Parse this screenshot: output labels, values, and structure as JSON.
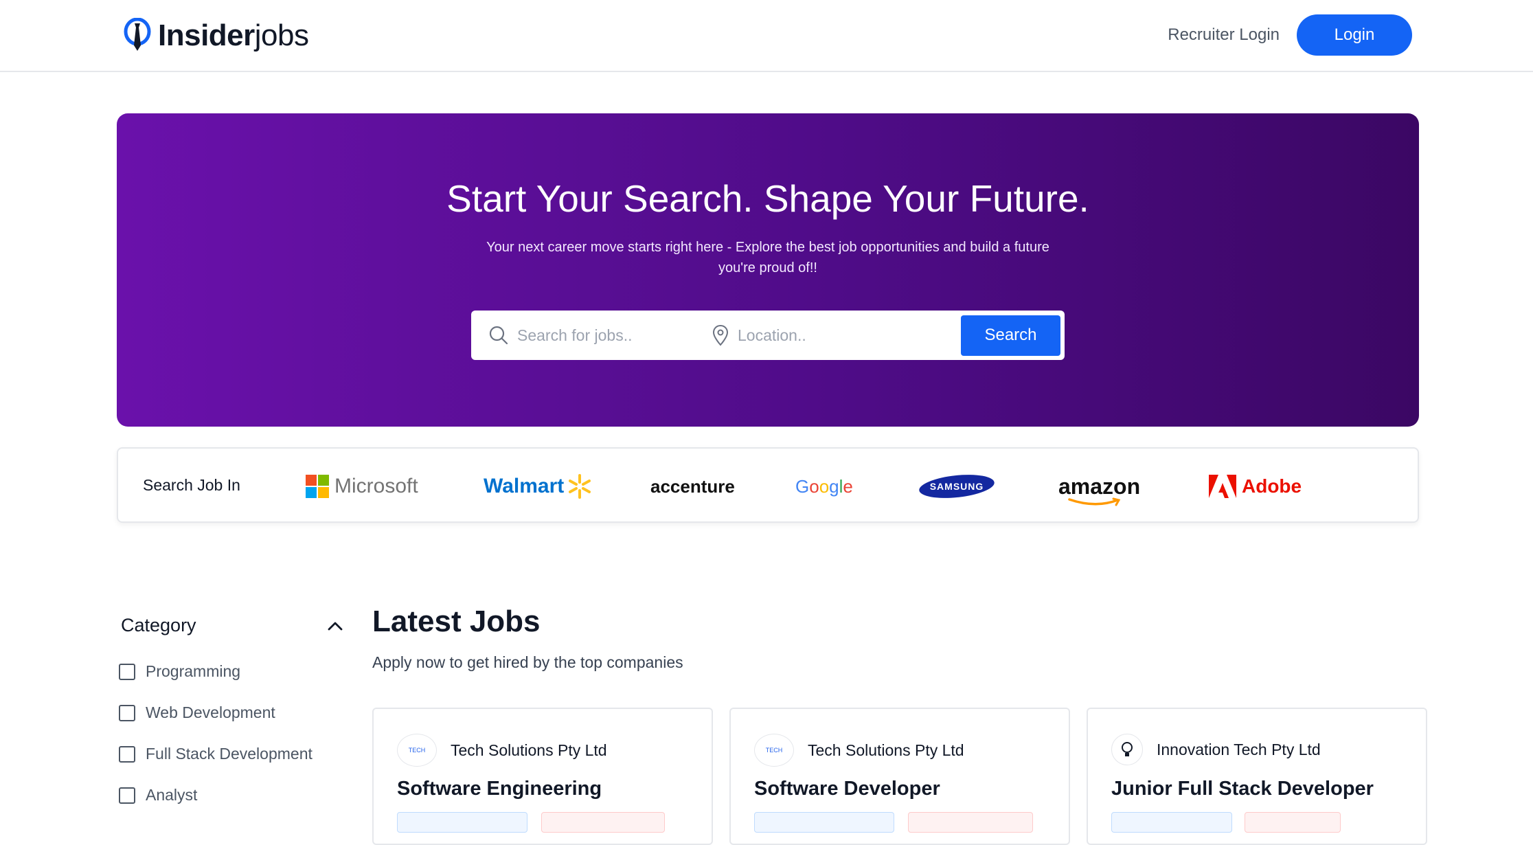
{
  "header": {
    "logo_bold": "Insider",
    "logo_light": "jobs",
    "recruiter_login": "Recruiter Login",
    "login": "Login"
  },
  "hero": {
    "title": "Start Your Search. Shape Your Future.",
    "subtitle": "Your next career move starts right here - Explore the best job opportunities and build a future you're proud of!!",
    "search_placeholder": "Search for jobs..",
    "location_placeholder": "Location..",
    "search_button": "Search"
  },
  "companies": {
    "label": "Search Job In",
    "items": [
      "Microsoft",
      "Walmart",
      "accenture",
      "Google",
      "SAMSUNG",
      "amazon",
      "Adobe"
    ]
  },
  "sidebar": {
    "category_title": "Category",
    "items": [
      "Programming",
      "Web Development",
      "Full Stack Development",
      "Analyst"
    ]
  },
  "latest": {
    "title": "Latest Jobs",
    "subtitle": "Apply now to get hired by the top companies",
    "jobs": [
      {
        "company": "Tech Solutions Pty Ltd",
        "title": "Software Engineering",
        "logo_text": "TECH"
      },
      {
        "company": "Tech Solutions Pty Ltd",
        "title": "Software Developer",
        "logo_text": "TECH"
      },
      {
        "company": "Innovation Tech Pty Ltd",
        "title": "Junior Full Stack Developer",
        "logo_text": ""
      }
    ]
  },
  "colors": {
    "primary": "#1464f5",
    "hero_start": "#6a11ab",
    "hero_end": "#3b0764"
  }
}
